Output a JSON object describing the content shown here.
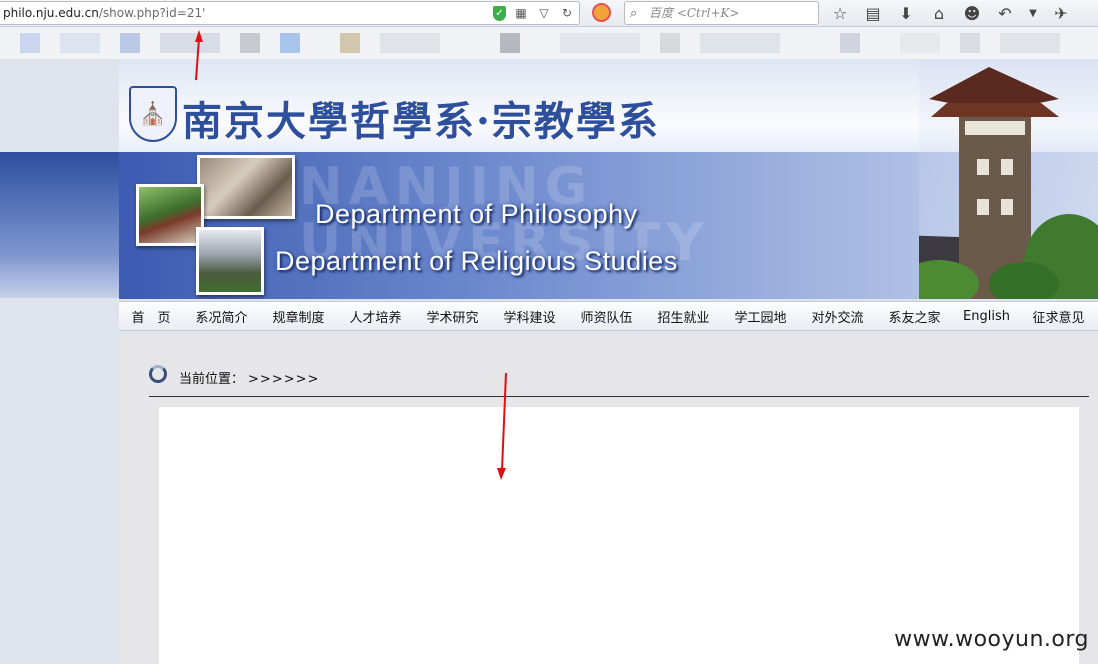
{
  "browser": {
    "url_domain": "philo.nju.edu.cn",
    "url_path": "/show.php?id=21'",
    "search_placeholder": "百度 <Ctrl+K>",
    "toolbar_icons": [
      "star-icon",
      "reading-list-icon",
      "download-icon",
      "home-icon",
      "chat-icon",
      "undo-icon",
      "dropdown-icon",
      "extension-icon"
    ]
  },
  "header": {
    "logo_text": "南京大學哲學系·宗教學系",
    "dept_philosophy": "Department of Philosophy",
    "dept_religious": "Department of Religious Studies"
  },
  "nav": {
    "items": [
      "首　页",
      "系况简介",
      "规章制度",
      "人才培养",
      "学术研究",
      "学科建设",
      "师资队伍",
      "招生就业",
      "学工园地",
      "对外交流",
      "系友之家",
      "English",
      "征求意见"
    ]
  },
  "content": {
    "breadcrumb_label": "当前位置：",
    "breadcrumb_trail": ">>>>>>"
  },
  "watermark": "www.wooyun.org",
  "colors": {
    "accent_blue": "#2e4f9b",
    "annotation_red": "#dd1111"
  }
}
